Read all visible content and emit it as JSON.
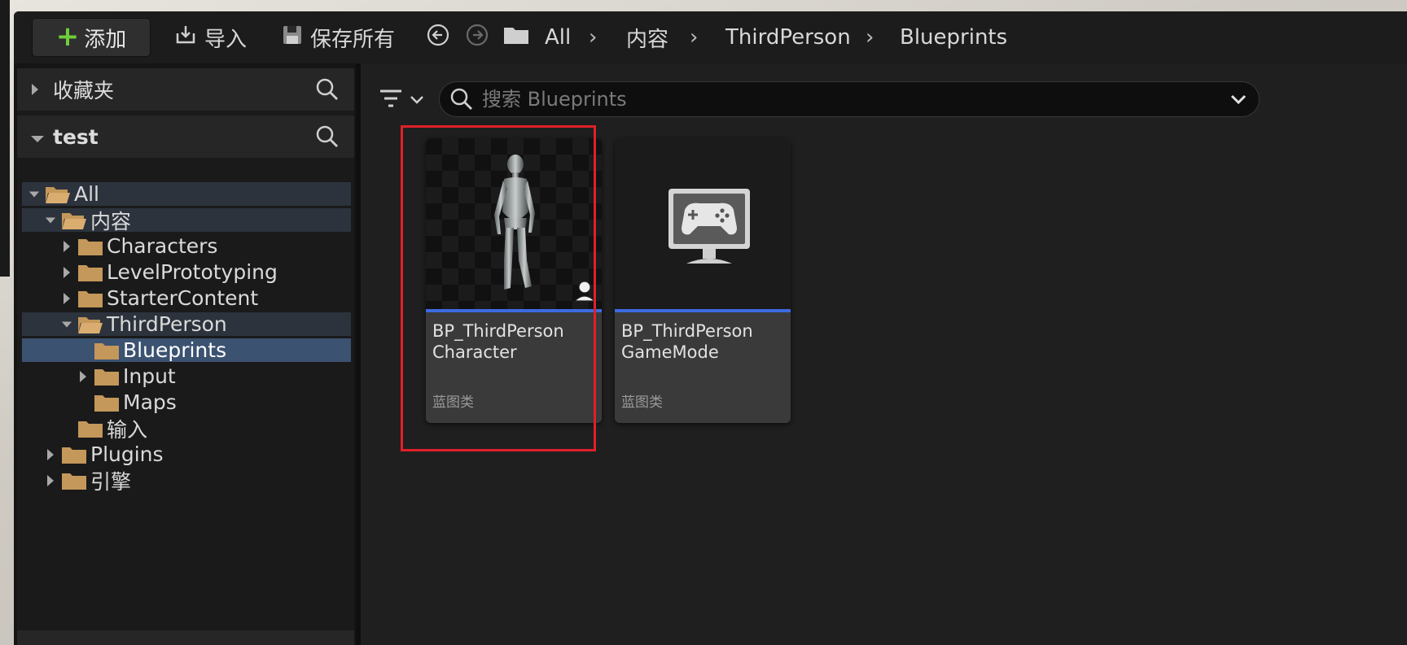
{
  "toolbar": {
    "add_label": "添加",
    "import_label": "导入",
    "save_all_label": "保存所有",
    "breadcrumb": [
      "All",
      "内容",
      "ThirdPerson",
      "Blueprints"
    ]
  },
  "sidebar": {
    "favorites_label": "收藏夹",
    "project_label": "test",
    "tree": [
      {
        "label": "All",
        "depth": 0,
        "expanded": true,
        "has_children": true
      },
      {
        "label": "内容",
        "depth": 1,
        "expanded": true,
        "has_children": true
      },
      {
        "label": "Characters",
        "depth": 2,
        "expanded": false,
        "has_children": true
      },
      {
        "label": "LevelPrototyping",
        "depth": 2,
        "expanded": false,
        "has_children": true
      },
      {
        "label": "StarterContent",
        "depth": 2,
        "expanded": false,
        "has_children": true
      },
      {
        "label": "ThirdPerson",
        "depth": 2,
        "expanded": true,
        "has_children": true
      },
      {
        "label": "Blueprints",
        "depth": 3,
        "expanded": false,
        "has_children": false,
        "selected": true
      },
      {
        "label": "Input",
        "depth": 3,
        "expanded": false,
        "has_children": true
      },
      {
        "label": "Maps",
        "depth": 3,
        "expanded": false,
        "has_children": false
      },
      {
        "label": "输入",
        "depth": 2,
        "expanded": false,
        "has_children": false
      },
      {
        "label": "Plugins",
        "depth": 1,
        "expanded": false,
        "has_children": true
      },
      {
        "label": "引擎",
        "depth": 1,
        "expanded": false,
        "has_children": true
      }
    ]
  },
  "content": {
    "search_placeholder": "搜索 Blueprints",
    "assets": [
      {
        "name_line1": "BP_ThirdPerson",
        "name_line2": "Character",
        "type": "蓝图类",
        "thumb": "character-mannequin",
        "highlighted": true
      },
      {
        "name_line1": "BP_ThirdPerson",
        "name_line2": "GameMode",
        "type": "蓝图类",
        "thumb": "gamemode-monitor-icon",
        "highlighted": false
      }
    ]
  },
  "colors": {
    "accent_blue": "#3d6ae0",
    "selection": "#3b5271",
    "highlight_red": "#e0202a",
    "add_green": "#6fcf3b",
    "folder": "#c4975a"
  }
}
